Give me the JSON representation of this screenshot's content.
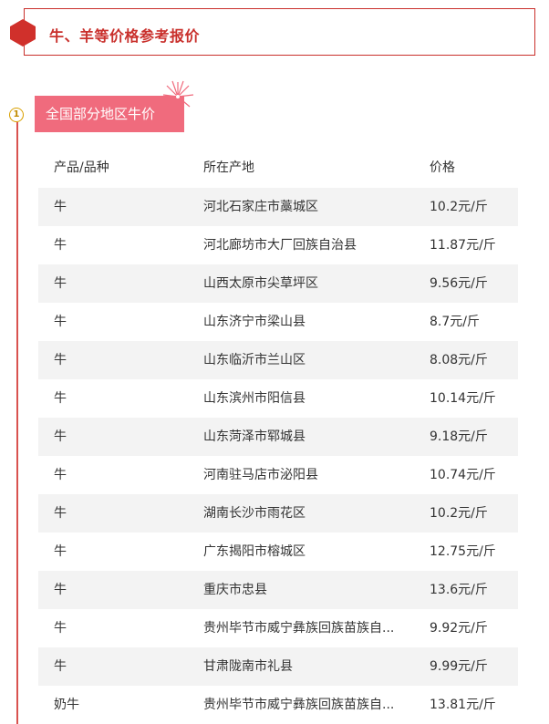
{
  "title": "牛、羊等价格参考报价",
  "step_number": "1",
  "section_label": "全国部分地区牛价",
  "table": {
    "headers": [
      "产品/品种",
      "所在产地",
      "价格"
    ],
    "rows": [
      [
        "牛",
        "河北石家庄市藁城区",
        "10.2元/斤"
      ],
      [
        "牛",
        "河北廊坊市大厂回族自治县",
        "11.87元/斤"
      ],
      [
        "牛",
        "山西太原市尖草坪区",
        "9.56元/斤"
      ],
      [
        "牛",
        "山东济宁市梁山县",
        "8.7元/斤"
      ],
      [
        "牛",
        "山东临沂市兰山区",
        "8.08元/斤"
      ],
      [
        "牛",
        "山东滨州市阳信县",
        "10.14元/斤"
      ],
      [
        "牛",
        "山东菏泽市郓城县",
        "9.18元/斤"
      ],
      [
        "牛",
        "河南驻马店市泌阳县",
        "10.74元/斤"
      ],
      [
        "牛",
        "湖南长沙市雨花区",
        "10.2元/斤"
      ],
      [
        "牛",
        "广东揭阳市榕城区",
        "12.75元/斤"
      ],
      [
        "牛",
        "重庆市忠县",
        "13.6元/斤"
      ],
      [
        "牛",
        "贵州毕节市威宁彝族回族苗族自...",
        "9.92元/斤"
      ],
      [
        "牛",
        "甘肃陇南市礼县",
        "9.99元/斤"
      ],
      [
        "奶牛",
        "贵州毕节市威宁彝族回族苗族自...",
        "13.81元/斤"
      ]
    ]
  },
  "colors": {
    "accent": "#c9302c",
    "tag": "#f06b7d",
    "row_shade": "#f3f3f3"
  },
  "icons": [
    "hexagon-icon",
    "firework-icon"
  ]
}
